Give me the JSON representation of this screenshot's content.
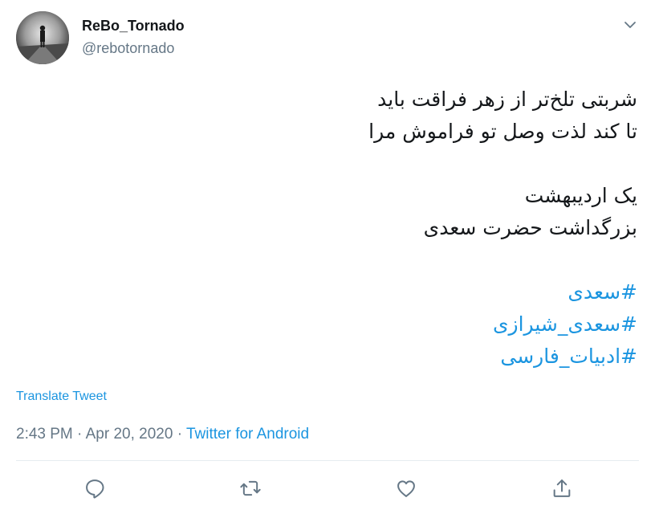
{
  "user": {
    "display_name": "ReBo_Tornado",
    "username": "@rebotornado"
  },
  "menu": {
    "icon": "chevron-down-icon"
  },
  "tweet": {
    "lines": [
      "شربتی تلخ‌تر از زهر فراقت باید",
      "تا کند لذت وصل تو فراموش مرا",
      "یک اردیبهشت",
      "بزرگداشت حضرت سعدی"
    ],
    "hashtags": [
      "#سعدی",
      "#سعدی_شیرازی",
      "#ادبیات_فارسی"
    ]
  },
  "translate_label": "Translate Tweet",
  "meta": {
    "time": "2:43 PM",
    "separator": " · ",
    "date": "Apr 20, 2020",
    "source": "Twitter for Android"
  },
  "actions": [
    {
      "name": "reply",
      "icon": "reply-icon"
    },
    {
      "name": "retweet",
      "icon": "retweet-icon"
    },
    {
      "name": "like",
      "icon": "heart-icon"
    },
    {
      "name": "share",
      "icon": "share-icon"
    }
  ],
  "colors": {
    "link": "#1b95e0",
    "secondary_text": "#657786",
    "primary_text": "#14171a",
    "divider": "#e6ecf0"
  }
}
